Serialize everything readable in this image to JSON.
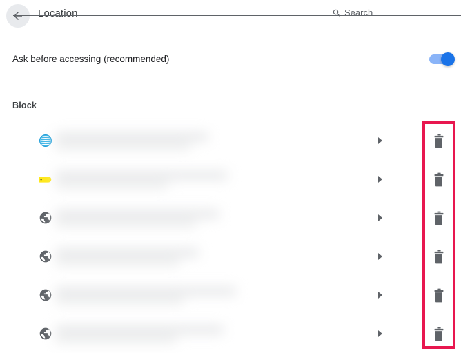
{
  "header": {
    "back_icon": "arrow-back-icon",
    "title": "Location",
    "search": {
      "icon": "search-icon",
      "placeholder": "Search",
      "value": ""
    }
  },
  "ask_setting": {
    "label": "Ask before accessing (recommended)",
    "toggle_state": "on",
    "toggle_on_track_color": "#8ab4f8",
    "toggle_on_knob_color": "#1a73e8"
  },
  "block_section": {
    "title": "Block",
    "rows": [
      {
        "favicon": "att-globe-icon",
        "site_label": "",
        "site_label_redacted": true,
        "expand_icon": "chevron-right-icon",
        "delete_icon": "trash-icon",
        "blur_line1_width": 222,
        "blur_line2_width": 196
      },
      {
        "favicon": "yellow-tag-icon",
        "site_label": "",
        "site_label_redacted": true,
        "expand_icon": "chevron-right-icon",
        "delete_icon": "trash-icon",
        "blur_line1_width": 250,
        "blur_line2_width": 164
      },
      {
        "favicon": "globe-icon",
        "site_label": "",
        "site_label_redacted": true,
        "expand_icon": "chevron-right-icon",
        "delete_icon": "trash-icon",
        "blur_line1_width": 238,
        "blur_line2_width": 204
      },
      {
        "favicon": "globe-icon",
        "site_label": "",
        "site_label_redacted": true,
        "expand_icon": "chevron-right-icon",
        "delete_icon": "trash-icon",
        "blur_line1_width": 208,
        "blur_line2_width": 180
      },
      {
        "favicon": "globe-icon",
        "site_label": "",
        "site_label_redacted": true,
        "expand_icon": "chevron-right-icon",
        "delete_icon": "trash-icon",
        "blur_line1_width": 262,
        "blur_line2_width": 186
      },
      {
        "favicon": "globe-icon",
        "site_label": "",
        "site_label_redacted": true,
        "expand_icon": "chevron-right-icon",
        "delete_icon": "trash-icon",
        "blur_line1_width": 244,
        "blur_line2_width": 176
      }
    ]
  },
  "annotation": {
    "name": "delete-column-highlight",
    "color": "#e8174f",
    "border_width": 4
  }
}
